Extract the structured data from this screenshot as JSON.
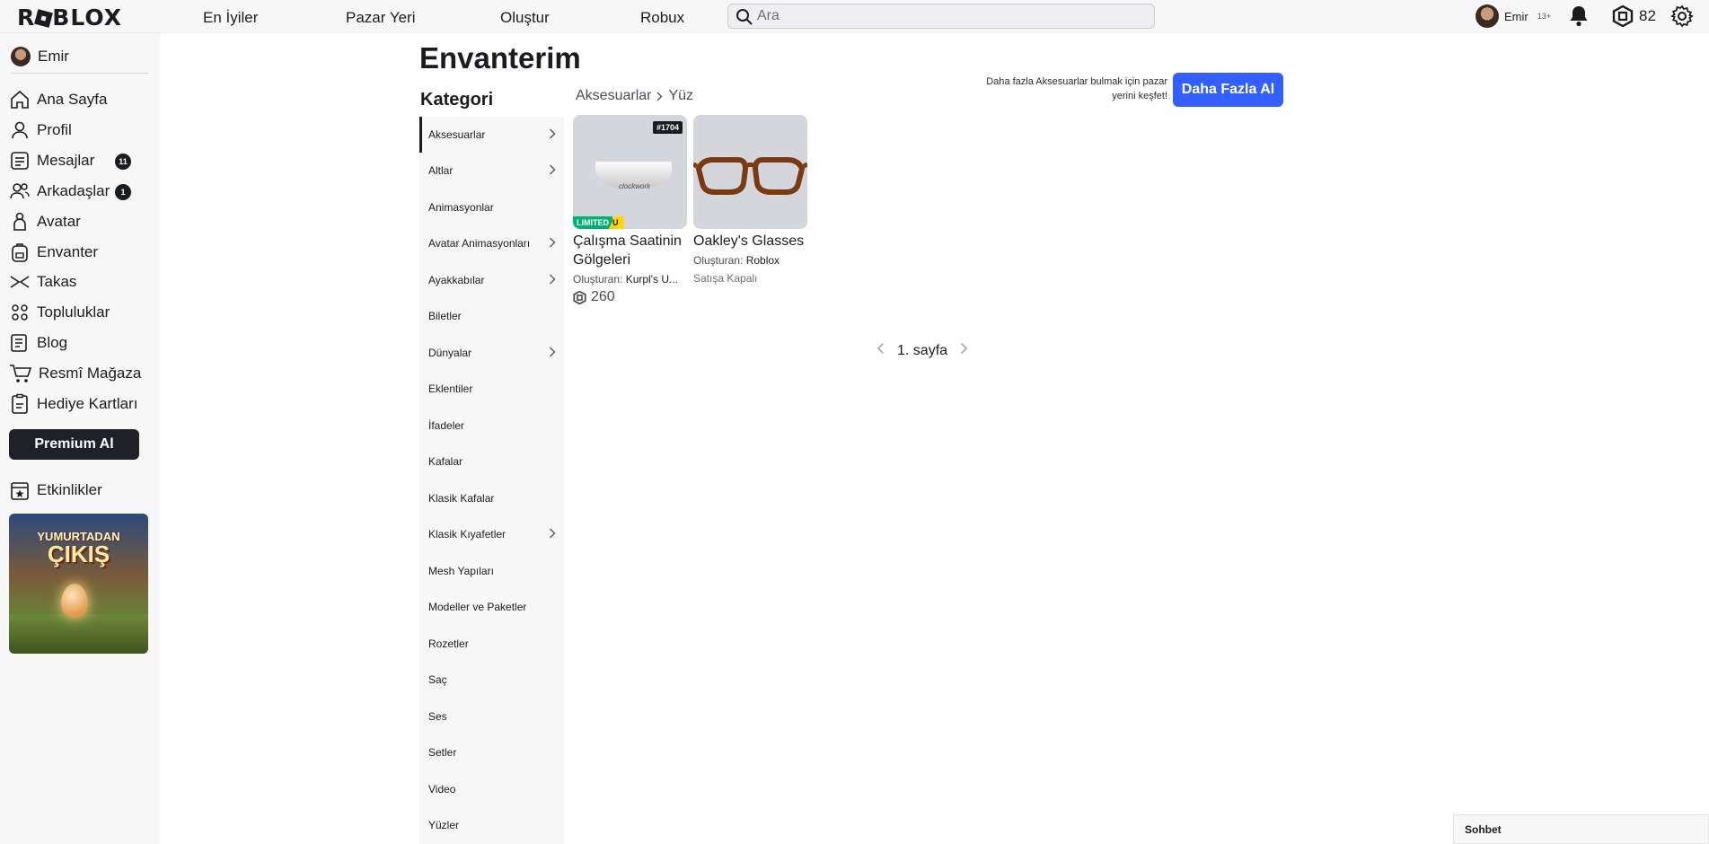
{
  "topbar": {
    "logo": "ROBLOX",
    "nav": [
      "En İyiler",
      "Pazar Yeri",
      "Oluştur",
      "Robux"
    ],
    "search_placeholder": "Ara",
    "username": "Emir",
    "age_badge": "13+",
    "robux": "82"
  },
  "sidebar": {
    "username": "Emir",
    "items": [
      {
        "label": "Ana Sayfa",
        "icon": "home-icon"
      },
      {
        "label": "Profil",
        "icon": "user-icon"
      },
      {
        "label": "Mesajlar",
        "icon": "messages-icon",
        "badge": "11"
      },
      {
        "label": "Arkadaşlar",
        "icon": "friends-icon",
        "badge": "1"
      },
      {
        "label": "Avatar",
        "icon": "avatar-icon"
      },
      {
        "label": "Envanter",
        "icon": "backpack-icon"
      },
      {
        "label": "Takas",
        "icon": "trade-icon"
      },
      {
        "label": "Topluluklar",
        "icon": "communities-icon"
      },
      {
        "label": "Blog",
        "icon": "blog-icon"
      },
      {
        "label": "Resmî Mağaza",
        "icon": "cart-icon"
      },
      {
        "label": "Hediye Kartları",
        "icon": "gift-card-icon"
      }
    ],
    "premium_label": "Premium Al",
    "events_label": "Etkinlikler",
    "banner_line1": "YUMURTADAN",
    "banner_line2": "ÇIKIŞ"
  },
  "main": {
    "title": "Envanterim",
    "category_title": "Kategori",
    "categories": [
      {
        "label": "Aksesuarlar",
        "chevron": true,
        "active": true
      },
      {
        "label": "Altlar",
        "chevron": true
      },
      {
        "label": "Animasyonlar",
        "chevron": false
      },
      {
        "label": "Avatar Animasyonları",
        "chevron": true
      },
      {
        "label": "Ayakkabılar",
        "chevron": true
      },
      {
        "label": "Biletler",
        "chevron": false
      },
      {
        "label": "Dünyalar",
        "chevron": true
      },
      {
        "label": "Eklentiler",
        "chevron": false
      },
      {
        "label": "İfadeler",
        "chevron": false
      },
      {
        "label": "Kafalar",
        "chevron": false
      },
      {
        "label": "Klasik Kafalar",
        "chevron": false
      },
      {
        "label": "Klasik Kıyafetler",
        "chevron": true
      },
      {
        "label": "Mesh Yapıları",
        "chevron": false
      },
      {
        "label": "Modeller ve Paketler",
        "chevron": false
      },
      {
        "label": "Rozetler",
        "chevron": false
      },
      {
        "label": "Saç",
        "chevron": false
      },
      {
        "label": "Ses",
        "chevron": false
      },
      {
        "label": "Setler",
        "chevron": false
      },
      {
        "label": "Video",
        "chevron": false
      },
      {
        "label": "Yüzler",
        "chevron": false
      }
    ],
    "breadcrumb": [
      "Aksesuarlar",
      "Yüz"
    ],
    "promo_text": "Daha fazla Aksesuarlar bulmak için pazar yerini keşfet!",
    "more_button": "Daha Fazla Al",
    "items": [
      {
        "name": "Çalışma Saatinin Gölgeleri",
        "creator_prefix": "Oluşturan:",
        "creator": "Kurpl's U...",
        "price": "260",
        "serial": "#1704",
        "limited_label": "LIMITED",
        "limited_u": "U",
        "thumb_text": "clockwork"
      },
      {
        "name": "Oakley's Glasses",
        "creator_prefix": "Oluşturan:",
        "creator": "Roblox",
        "status": "Satışa Kapalı"
      }
    ],
    "pager_label": "1. sayfa"
  },
  "chat": {
    "label": "Sohbet"
  }
}
